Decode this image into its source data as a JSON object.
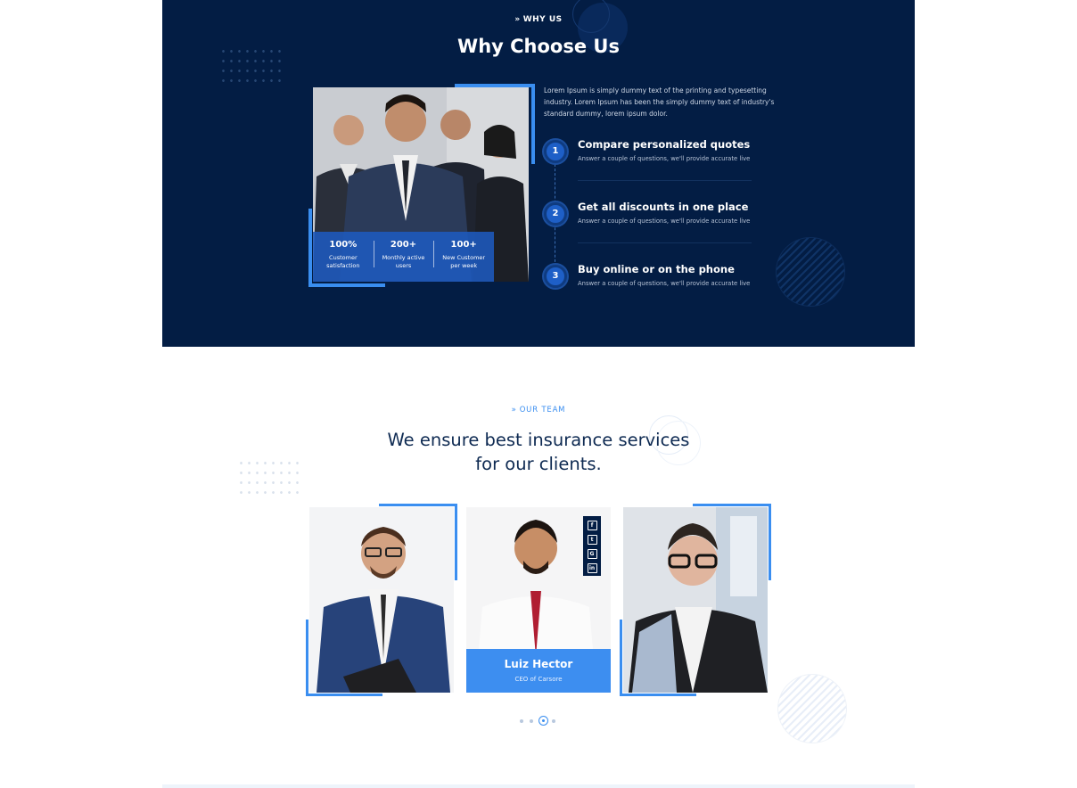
{
  "why_us": {
    "eyebrow": "WHY US",
    "title": "Why Choose Us",
    "intro": "Lorem Ipsum is simply dummy text of the printing and typesetting industry. Lorem Ipsum has been the simply dummy text of industry's standard dummy, lorem ipsum dolor.",
    "stats": [
      {
        "value": "100%",
        "label": "Customer satisfaction"
      },
      {
        "value": "200+",
        "label": "Monthly active users"
      },
      {
        "value": "100+",
        "label": "New Customer per week"
      }
    ],
    "steps": [
      {
        "number": "1",
        "title": "Compare personalized quotes",
        "desc": "Answer a couple of questions, we'll provide accurate live"
      },
      {
        "number": "2",
        "title": "Get all discounts in one place",
        "desc": "Answer a couple of questions, we'll provide accurate live"
      },
      {
        "number": "3",
        "title": "Buy online or on the phone",
        "desc": "Answer a couple of questions, we'll provide accurate live"
      }
    ]
  },
  "team": {
    "eyebrow": "OUR TEAM",
    "title_line1": "We ensure best insurance services",
    "title_line2": "for our clients.",
    "featured": {
      "name": "Luiz Hector",
      "role": "CEO of Carsore"
    },
    "social": [
      {
        "icon": "facebook-icon",
        "glyph": "f"
      },
      {
        "icon": "twitter-icon",
        "glyph": "t"
      },
      {
        "icon": "google-icon",
        "glyph": "G"
      },
      {
        "icon": "linkedin-icon",
        "glyph": "in"
      }
    ],
    "pager": {
      "count": 4,
      "active": 2
    }
  },
  "colors": {
    "navy": "#031d44",
    "accent": "#3a8ef0",
    "heading_dark": "#0e2a52"
  }
}
